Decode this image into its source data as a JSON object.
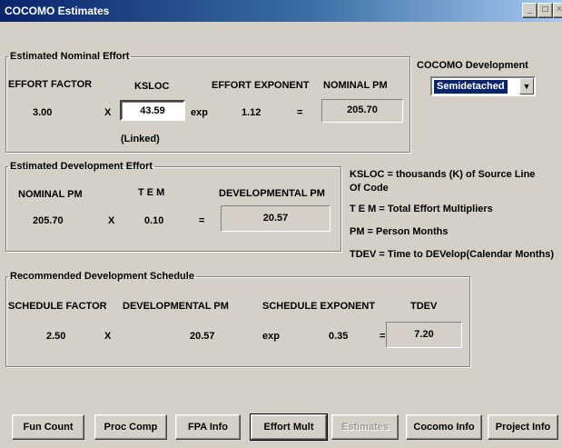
{
  "window": {
    "title": "COCOMO Estimates",
    "min_glyph": "_",
    "max_glyph": "□",
    "close_glyph": "×"
  },
  "nominal": {
    "legend": "Estimated Nominal Effort",
    "effort_factor_label": "EFFORT FACTOR",
    "effort_factor": "3.00",
    "times": "X",
    "ksloc_label": "KSLOC",
    "ksloc_value": "43.59",
    "linked": "(Linked)",
    "exp": "exp",
    "exponent_label": "EFFORT EXPONENT",
    "exponent": "1.12",
    "equals": "=",
    "pm_label": "NOMINAL PM",
    "pm_value": "205.70"
  },
  "development_mode": {
    "label": "COCOMO Development",
    "selected": "Semidetached"
  },
  "development": {
    "legend": "Estimated Development Effort",
    "nominal_pm_label": "NOMINAL PM",
    "nominal_pm": "205.70",
    "times": "X",
    "tem_label": "T E M",
    "tem": "0.10",
    "equals": "=",
    "dev_pm_label": "DEVELOPMENTAL PM",
    "dev_pm": "20.57"
  },
  "glossary": {
    "ksloc_line1": "KSLOC = thousands (K) of Source Line",
    "ksloc_line2": "Of Code",
    "tem": "T E M = Total Effort Multipliers",
    "pm": "PM = Person Months",
    "tdev": "TDEV = Time to DEVelop(Calendar Months)"
  },
  "schedule": {
    "legend": "Recommended Development Schedule",
    "factor_label": "SCHEDULE FACTOR",
    "factor": "2.50",
    "times": "X",
    "dev_pm_label": "DEVELOPMENTAL PM",
    "dev_pm": "20.57",
    "exp": "exp",
    "exponent_label": "SCHEDULE EXPONENT",
    "exponent": "0.35",
    "equals": "=",
    "tdev_label": "TDEV",
    "tdev": "7.20"
  },
  "buttons": {
    "fun_count": "Fun Count",
    "proc_comp": "Proc Comp",
    "fpa_info": "FPA Info",
    "effort_mult": "Effort Mult",
    "estimates": "Estimates",
    "cocomo_info": "Cocomo Info",
    "project_info": "Project Info"
  }
}
